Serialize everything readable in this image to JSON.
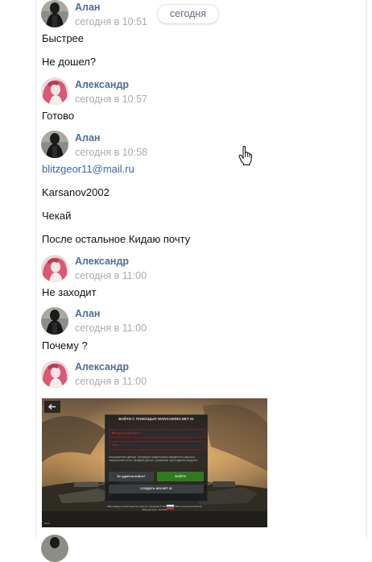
{
  "date_pill": "сегодня",
  "messages": [
    {
      "author": "Алан",
      "time": "сегодня в 10:51",
      "lines": [
        "Быстрее",
        "Не дошел?"
      ]
    },
    {
      "author": "Александр",
      "time": "сегодня в 10:57",
      "lines": [
        "Готово"
      ]
    },
    {
      "author": "Алан",
      "time": "сегодня в 10:58",
      "lines": [
        "blitzgeor11@mail.ru",
        "Karsanov2002",
        "Чекай",
        "После остальное Кидаю почту"
      ]
    },
    {
      "author": "Александр",
      "time": "сегодня в 11:00",
      "lines": [
        "Не заходит"
      ]
    },
    {
      "author": "Алан",
      "time": "сегодня в 11:00",
      "lines": [
        "Почему ?"
      ]
    },
    {
      "author": "Александр",
      "time": "сегодня в 11:00",
      "lines": []
    }
  ],
  "attachment": {
    "dialog_title": "ВОЙТИ С ПОМОЩЬЮ WARGAMING.NET ID",
    "field_email": "blitzgeor11@mail.ru",
    "field_password": "••••••",
    "error_text": "Неккоректные данные. Проверьте правильность введённого пароля и электронной почты. Выйдите делать, указанные при создании аккаунта.",
    "btn_forgot": "Не удаётся войти?",
    "btn_login": "ВОЙТИ",
    "btn_create": "СОЗДАТЬ WG.NET ID",
    "footer_text": "Ваш аккаунт используется в игре по лицензии © 2014–2018 WG и в регионе Россия",
    "footer_links": "Мир доступа · Россия",
    "version": "5.4.0"
  },
  "colors": {
    "author": "#4f6d94",
    "time": "#a7abb3",
    "link": "#3a65a7",
    "login_button": "#2f7a1f"
  },
  "icons": [
    "hand-cursor-icon",
    "back-arrow-icon",
    "close-icon",
    "russia-flag-icon"
  ]
}
